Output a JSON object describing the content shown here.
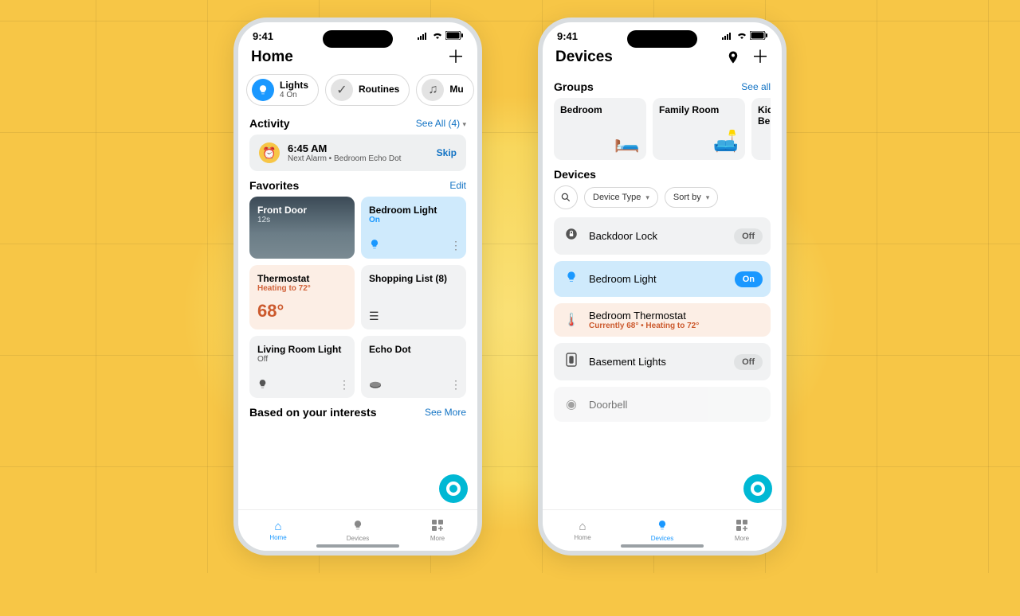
{
  "status": {
    "time": "9:41"
  },
  "left": {
    "title": "Home",
    "chips": [
      {
        "label": "Lights",
        "sub": "4 On",
        "active": true
      },
      {
        "label": "Routines",
        "sub": ""
      },
      {
        "label": "Mu",
        "sub": ""
      }
    ],
    "activity": {
      "title": "Activity",
      "see_all": "See All (4)",
      "alarm": {
        "time": "6:45 AM",
        "sub": "Next Alarm • Bedroom Echo Dot",
        "skip": "Skip"
      }
    },
    "favorites": {
      "title": "Favorites",
      "edit": "Edit",
      "cards": {
        "cam": {
          "title": "Front Door",
          "sub": "12s"
        },
        "bedlight": {
          "title": "Bedroom Light",
          "sub": "On"
        },
        "thermo": {
          "title": "Thermostat",
          "sub": "Heating to 72°",
          "value": "68°"
        },
        "shop": {
          "title": "Shopping List (8)"
        },
        "living": {
          "title": "Living Room Light",
          "sub": "Off"
        },
        "echo": {
          "title": "Echo Dot"
        }
      }
    },
    "interests": {
      "title": "Based on your interests",
      "see_more": "See More"
    },
    "tabs": {
      "home": "Home",
      "devices": "Devices",
      "more": "More"
    }
  },
  "right": {
    "title": "Devices",
    "groups": {
      "title": "Groups",
      "see_all": "See all",
      "items": [
        "Bedroom",
        "Family Room",
        "Kids Be"
      ]
    },
    "devices_section": {
      "title": "Devices",
      "filter_type": "Device Type",
      "sort_by": "Sort by",
      "rows": {
        "backdoor": {
          "name": "Backdoor Lock",
          "state": "Off"
        },
        "bedlight": {
          "name": "Bedroom Light",
          "state": "On"
        },
        "thermo": {
          "name": "Bedroom Thermostat",
          "sub": "Currently 68° • Heating to 72°"
        },
        "basement": {
          "name": "Basement Lights",
          "state": "Off"
        },
        "doorbell": {
          "name": "Doorbell"
        }
      }
    },
    "tabs": {
      "home": "Home",
      "devices": "Devices",
      "more": "More"
    }
  }
}
